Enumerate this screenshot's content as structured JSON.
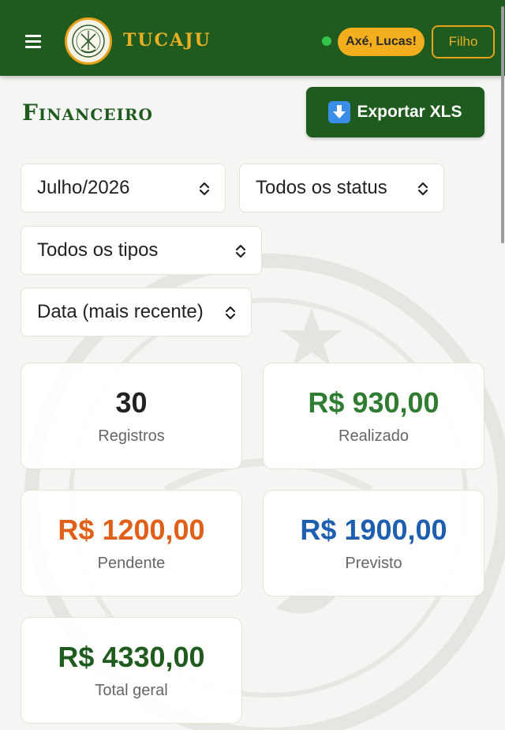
{
  "header": {
    "brand": "TUCAJU",
    "greeting": "Axé, Lucas!",
    "role_button": "Filho",
    "icons": {
      "menu": "hamburger-icon",
      "logo": "tucaju-logo",
      "status": "online-dot"
    }
  },
  "page": {
    "title": "Financeiro",
    "export_label": "Exportar XLS",
    "export_icon": "download-arrow-icon"
  },
  "filters": {
    "month": "Julho/2026",
    "status": "Todos os status",
    "type": "Todos os tipos",
    "sort": "Data (mais recente)"
  },
  "summary": [
    {
      "value": "30",
      "label": "Registros",
      "color": "#222222"
    },
    {
      "value": "R$ 930,00",
      "label": "Realizado",
      "color": "#2e7d32"
    },
    {
      "value": "R$ 1200,00",
      "label": "Pendente",
      "color": "#e0601a"
    },
    {
      "value": "R$ 1900,00",
      "label": "Previsto",
      "color": "#1f5fb0"
    },
    {
      "value": "R$ 4330,00",
      "label": "Total geral",
      "color": "#1f5a1f"
    }
  ],
  "colors": {
    "header_bg": "#1f5a1f",
    "accent_gold": "#e8b022",
    "online": "#33c24a"
  }
}
